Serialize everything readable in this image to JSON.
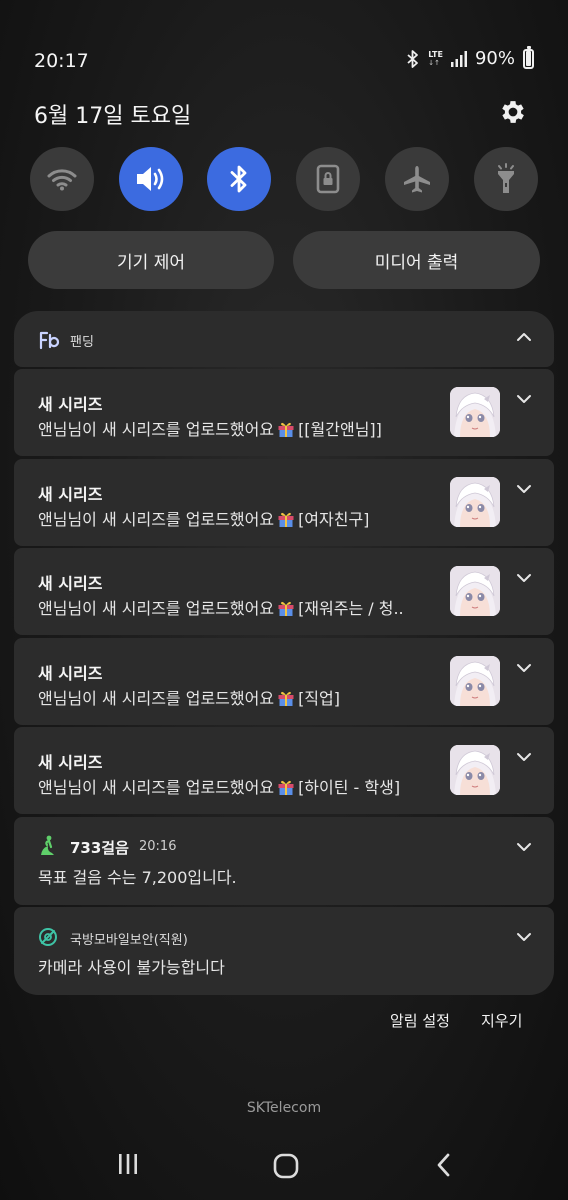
{
  "status_bar": {
    "time": "20:17",
    "network_label": "LTE",
    "battery_percent_label": "90%",
    "battery_level": 0.9
  },
  "header": {
    "date": "6월 17일 토요일"
  },
  "quick_toggles": [
    {
      "icon": "wifi-icon",
      "active": false
    },
    {
      "icon": "sound-icon",
      "active": true
    },
    {
      "icon": "bluetooth-icon",
      "active": true
    },
    {
      "icon": "lock-rotation-icon",
      "active": false
    },
    {
      "icon": "airplane-icon",
      "active": false
    },
    {
      "icon": "flashlight-icon",
      "active": false
    }
  ],
  "quick_buttons": {
    "device_control": "기기 제어",
    "media_output": "미디어 출력"
  },
  "fanding": {
    "app_name": "팬딩",
    "notifications": [
      {
        "title": "새 시리즈",
        "text": "앤님님이 새 시리즈를 업로드했어요",
        "tag": "[[월간앤님]]"
      },
      {
        "title": "새 시리즈",
        "text": "앤님님이 새 시리즈를 업로드했어요",
        "tag": "[여자친구]"
      },
      {
        "title": "새 시리즈",
        "text": "앤님님이 새 시리즈를 업로드했어요",
        "tag": "[재워주는 / 청.."
      },
      {
        "title": "새 시리즈",
        "text": "앤님님이 새 시리즈를 업로드했어요",
        "tag": "[직업]"
      },
      {
        "title": "새 시리즈",
        "text": "앤님님이 새 시리즈를 업로드했어요",
        "tag": "[하이틴 - 학생]"
      }
    ]
  },
  "steps": {
    "title": "733걸음",
    "time": "20:16",
    "text": "목표 걸음 수는 7,200입니다."
  },
  "security": {
    "app_name": "국방모바일보안(직원)",
    "text": "카메라 사용이 불가능합니다"
  },
  "actions": {
    "notification_settings": "알림 설정",
    "clear": "지우기"
  },
  "carrier": "SKTelecom",
  "colors": {
    "accent": "#3c6be0",
    "card": "#2c2c2c",
    "steps_green": "#5fcf6a",
    "security_teal": "#3ec3a5"
  }
}
